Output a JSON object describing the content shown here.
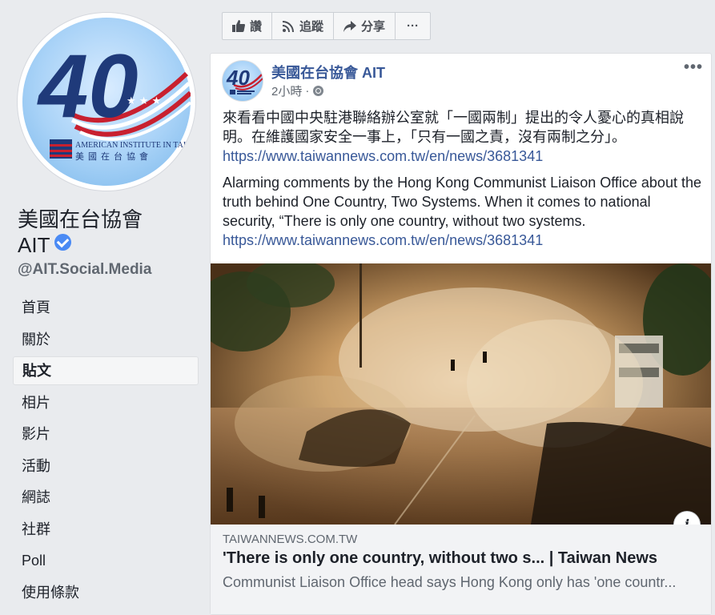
{
  "page": {
    "name_line1": "美國在台協會",
    "name_line2": "AIT",
    "handle": "@AIT.Social.Media",
    "logo_number": "40",
    "logo_text_en": "AMERICAN INSTITUTE IN TAIWAN",
    "logo_text_zh": "美國在台協會"
  },
  "nav": [
    {
      "label": "首頁",
      "active": false
    },
    {
      "label": "關於",
      "active": false
    },
    {
      "label": "貼文",
      "active": true
    },
    {
      "label": "相片",
      "active": false
    },
    {
      "label": "影片",
      "active": false
    },
    {
      "label": "活動",
      "active": false
    },
    {
      "label": "網誌",
      "active": false
    },
    {
      "label": "社群",
      "active": false
    },
    {
      "label": "Poll",
      "active": false
    },
    {
      "label": "使用條款",
      "active": false
    }
  ],
  "actions": {
    "like": "讚",
    "follow": "追蹤",
    "share": "分享",
    "more": "···"
  },
  "post": {
    "author": "美國在台協會 AIT",
    "time": "2小時",
    "separator": "·",
    "more": "•••",
    "text_zh": "來看看中國中央駐港聯絡辦公室就「一國兩制」提出的令人憂心的真相說明。在維護國家安全一事上，「只有一國之責，沒有兩制之分」。",
    "link_url_1": "https://www.taiwannews.com.tw/en/news/3681341",
    "text_en": "Alarming comments by the Hong Kong Communist Liaison Office about the truth behind One Country, Two Systems. When it comes to national security, “There is only one country, without two systems.",
    "link_url_2": "https://www.taiwannews.com.tw/en/news/3681341",
    "info_glyph": "i"
  },
  "link_preview": {
    "domain": "TAIWANNEWS.COM.TW",
    "title": "'There is only one country, without two s... | Taiwan News",
    "description": "Communist Liaison Office head says Hong Kong only has 'one countr..."
  },
  "colors": {
    "background": "#e9ebee",
    "link": "#385898",
    "logo_navy": "#1f3a7a",
    "logo_red": "#c8202f",
    "verified": "#4a8af4"
  }
}
